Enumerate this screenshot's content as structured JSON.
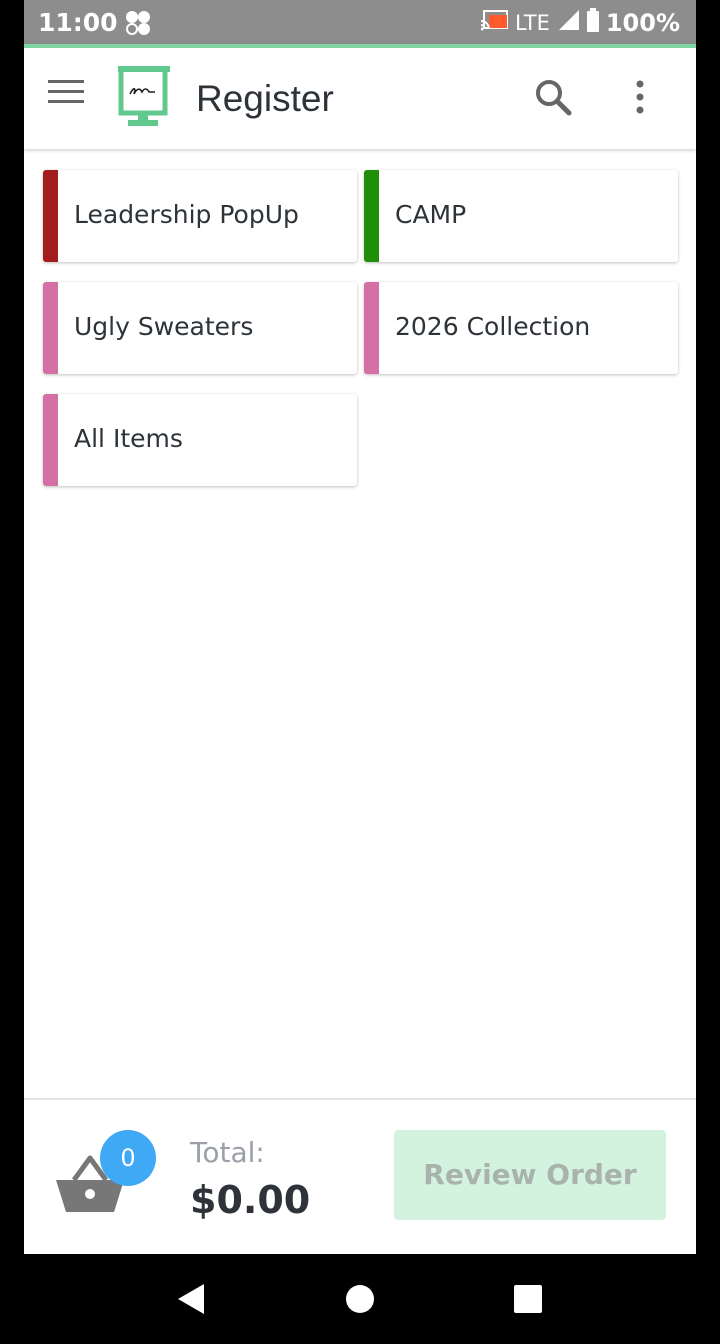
{
  "status_bar": {
    "time": "11:00",
    "network": "LTE",
    "battery": "100%",
    "icons": [
      "cast-icon",
      "signal-icon",
      "battery-icon",
      "app-notification-icon"
    ],
    "accent_color": "#7fd6a0"
  },
  "toolbar": {
    "title": "Register",
    "icons": [
      "menu-icon",
      "register-logo-icon",
      "search-icon",
      "more-vert-icon"
    ]
  },
  "categories": [
    {
      "label": "Leadership PopUp",
      "color": "#a51c1c"
    },
    {
      "label": "CAMP",
      "color": "#1f8f0a"
    },
    {
      "label": "Ugly Sweaters",
      "color": "#d570a5"
    },
    {
      "label": "2026 Collection",
      "color": "#d570a5"
    },
    {
      "label": "All Items",
      "color": "#d570a5"
    }
  ],
  "footer": {
    "cart_count": "0",
    "total_label": "Total:",
    "total_value": "$0.00",
    "review_button": "Review Order",
    "badge_color": "#3fa9f5",
    "button_color": "#d3f3df"
  },
  "navigation_bar": {
    "icons": [
      "back-icon",
      "home-icon",
      "recents-icon"
    ]
  }
}
